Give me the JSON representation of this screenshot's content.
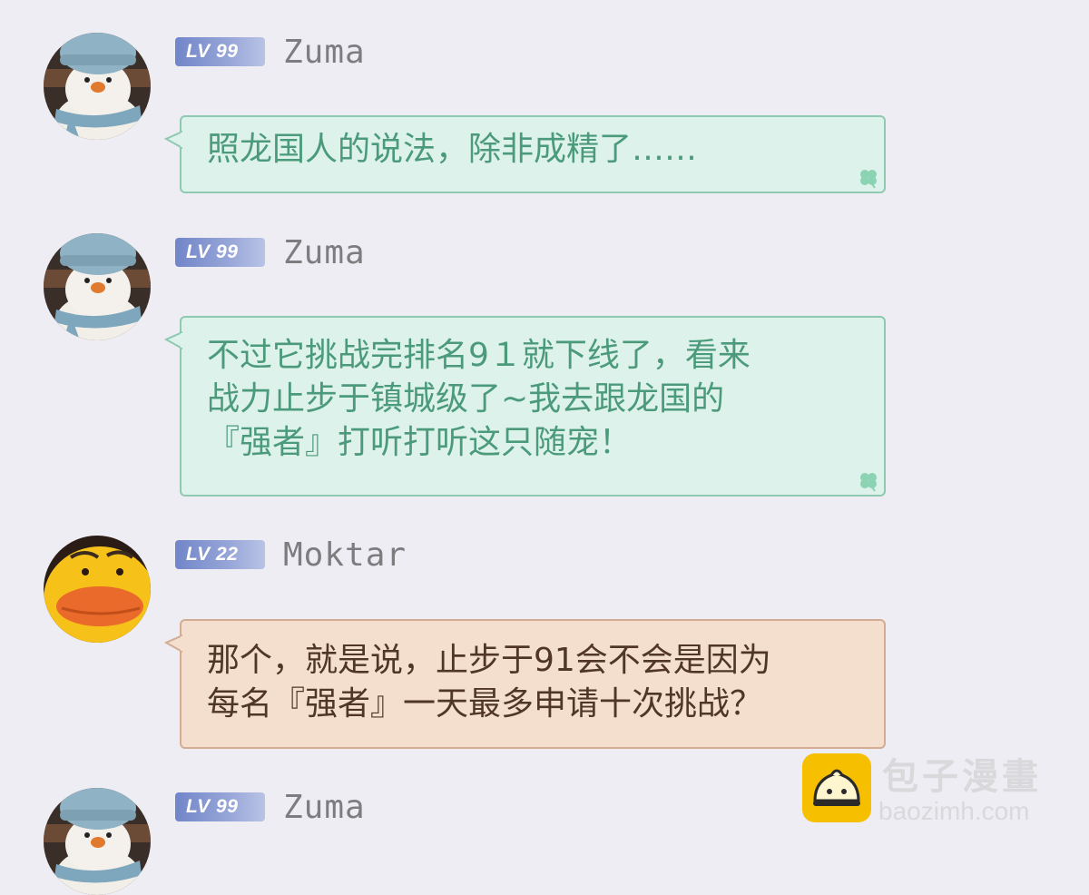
{
  "messages": [
    {
      "avatar": "snowman-avatar",
      "level": "LV 99",
      "name": "Zuma",
      "style": "green",
      "lines": [
        "照龙国人的说法，除非成精了……"
      ]
    },
    {
      "avatar": "snowman-avatar",
      "level": "LV 99",
      "name": "Zuma",
      "style": "green",
      "lines": [
        "不过它挑战完排名9１就下线了，看来",
        "战力止步于镇城级了~我去跟龙国的",
        "『强者』打听打听这只随宠！"
      ]
    },
    {
      "avatar": "duck-avatar",
      "level": "LV 22",
      "name": "Moktar",
      "style": "tan",
      "lines": [
        "那个，就是说，止步于91会不会是因为",
        "每名『强者』一天最多申请十次挑战？"
      ]
    },
    {
      "avatar": "snowman-avatar",
      "level": "LV 99",
      "name": "Zuma",
      "style": "none",
      "lines": []
    }
  ],
  "watermark": {
    "title": "包子漫畫",
    "url": "baozimh.com",
    "logo_icon": "bun-logo-icon"
  },
  "colors": {
    "background": "#eeedf3",
    "green_bubble": "#dcf2ea",
    "green_text": "#4c9a7c",
    "tan_bubble": "#f4dfce",
    "tan_text": "#503627",
    "badge": "#7186c9"
  }
}
